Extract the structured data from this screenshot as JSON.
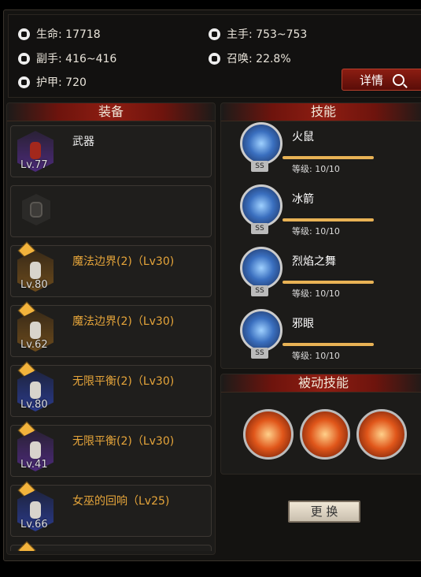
{
  "stats": {
    "hp": "生命: 17718",
    "main_hand": "主手: 753~753",
    "off_hand": "副手: 416~416",
    "summon": "召唤: 22.8%",
    "armor": "护甲: 720"
  },
  "detail_button": "详情",
  "equipment": {
    "title": "装备",
    "slots": [
      {
        "name": "武器",
        "level": "Lv.77",
        "name_color": "white",
        "icon": "weapon-icon"
      },
      {
        "name": "",
        "level": "",
        "name_color": "white",
        "icon": "empty-shield-icon"
      },
      {
        "name": "魔法边界(2)（Lv30)",
        "level": "Lv.80",
        "name_color": "gold",
        "icon": "armor-chest-icon"
      },
      {
        "name": "魔法边界(2)（Lv30)",
        "level": "Lv.62",
        "name_color": "gold",
        "icon": "gloves-icon"
      },
      {
        "name": "无限平衡(2)（Lv30)",
        "level": "Lv.80",
        "name_color": "gold",
        "icon": "gauntlet-icon"
      },
      {
        "name": "无限平衡(2)（Lv30)",
        "level": "Lv.41",
        "name_color": "gold",
        "icon": "boots-icon"
      },
      {
        "name": "女巫的回响（Lv25)",
        "level": "Lv.66",
        "name_color": "gold",
        "icon": "ring-icon"
      }
    ]
  },
  "skills": {
    "title": "技能",
    "items": [
      {
        "name": "火鼠",
        "level": "等级: 10/10",
        "rank": "SS"
      },
      {
        "name": "冰箭",
        "level": "等级: 10/10",
        "rank": "SS"
      },
      {
        "name": "烈焰之舞",
        "level": "等级: 10/10",
        "rank": "SS"
      },
      {
        "name": "邪眼",
        "level": "等级: 10/10",
        "rank": "SS"
      }
    ]
  },
  "passive_skills": {
    "title": "被动技能",
    "icons": [
      "flame-swirl-icon",
      "hourglass-icon",
      "fire-warrior-icon"
    ]
  },
  "change_button": "更 换"
}
